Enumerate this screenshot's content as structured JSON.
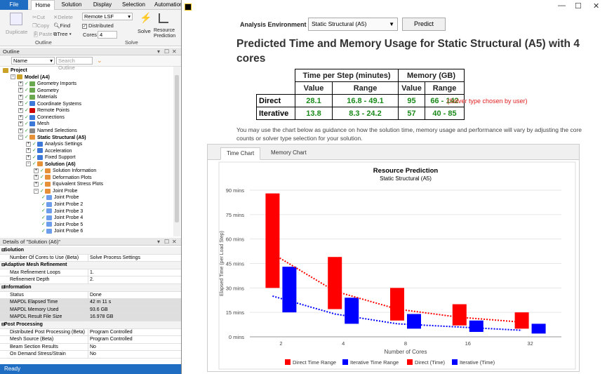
{
  "ribbon": {
    "tabs": [
      "File",
      "Home",
      "Solution",
      "Display",
      "Selection",
      "Automation"
    ],
    "duplicate_label": "Duplicate",
    "cut_label": "Cut",
    "delete_label": "Delete",
    "copy_label": "Copy",
    "find_label": "Find",
    "paste_label": "Paste",
    "tree_label": "Tree",
    "outline_group": "Outline",
    "solve_target": "Remote LSF",
    "distributed_label": "Distributed",
    "cores_label": "Cores",
    "cores_value": "4",
    "solve_label": "Solve",
    "resource_prediction_label": "Resource Prediction",
    "solve_group": "Solve"
  },
  "outline": {
    "title": "Outline",
    "name_label": "Name",
    "search_placeholder": "Search Outline",
    "items": [
      {
        "label": "Project",
        "depth": 0,
        "icon": "project-icon",
        "color": "#c9a227",
        "bold": true
      },
      {
        "label": "Model (A4)",
        "depth": 1,
        "icon": "model-icon",
        "color": "#c9a227",
        "bold": true
      },
      {
        "label": "Geometry Imports",
        "depth": 2,
        "icon": "geometry-imports-icon",
        "color": "#6aa84f"
      },
      {
        "label": "Geometry",
        "depth": 2,
        "icon": "geometry-icon",
        "color": "#6aa84f"
      },
      {
        "label": "Materials",
        "depth": 2,
        "icon": "materials-icon",
        "color": "#6aa84f"
      },
      {
        "label": "Coordinate Systems",
        "depth": 2,
        "icon": "coordinate-systems-icon",
        "color": "#3c78d8"
      },
      {
        "label": "Remote Points",
        "depth": 2,
        "icon": "remote-points-icon",
        "color": "#cc0000"
      },
      {
        "label": "Connections",
        "depth": 2,
        "icon": "connections-icon",
        "color": "#3c78d8"
      },
      {
        "label": "Mesh",
        "depth": 2,
        "icon": "mesh-icon",
        "color": "#3c78d8"
      },
      {
        "label": "Named Selections",
        "depth": 2,
        "icon": "named-selections-icon",
        "color": "#888888"
      },
      {
        "label": "Static Structural (A5)",
        "depth": 2,
        "icon": "static-structural-icon",
        "color": "#e69138",
        "bold": true
      },
      {
        "label": "Analysis Settings",
        "depth": 3,
        "icon": "analysis-settings-icon",
        "color": "#3c78d8"
      },
      {
        "label": "Acceleration",
        "depth": 3,
        "icon": "acceleration-icon",
        "color": "#3c78d8"
      },
      {
        "label": "Fixed Support",
        "depth": 3,
        "icon": "fixed-support-icon",
        "color": "#3c78d8"
      },
      {
        "label": "Solution (A6)",
        "depth": 3,
        "icon": "solution-icon",
        "color": "#e69138",
        "bold": true
      },
      {
        "label": "Solution Information",
        "depth": 4,
        "icon": "solution-information-icon",
        "color": "#e69138"
      },
      {
        "label": "Deformation Plots",
        "depth": 4,
        "icon": "deformation-plots-icon",
        "color": "#e69138"
      },
      {
        "label": "Equivalent Stress Plots",
        "depth": 4,
        "icon": "equivalent-stress-plots-icon",
        "color": "#e69138"
      },
      {
        "label": "Joint Probe",
        "depth": 4,
        "icon": "joint-probe-folder-icon",
        "color": "#e69138"
      },
      {
        "label": "Joint Probe",
        "depth": 5,
        "icon": "joint-probe-icon",
        "color": "#6d9eeb"
      },
      {
        "label": "Joint Probe 2",
        "depth": 5,
        "icon": "joint-probe-icon",
        "color": "#6d9eeb"
      },
      {
        "label": "Joint Probe 3",
        "depth": 5,
        "icon": "joint-probe-icon",
        "color": "#6d9eeb"
      },
      {
        "label": "Joint Probe 4",
        "depth": 5,
        "icon": "joint-probe-icon",
        "color": "#6d9eeb"
      },
      {
        "label": "Joint Probe 5",
        "depth": 5,
        "icon": "joint-probe-icon",
        "color": "#6d9eeb"
      },
      {
        "label": "Joint Probe 6",
        "depth": 5,
        "icon": "joint-probe-icon",
        "color": "#6d9eeb"
      }
    ]
  },
  "details": {
    "title": "Details of \"Solution (A6)\"",
    "rows": [
      {
        "key": "Solution",
        "section": true
      },
      {
        "key": "Number Of Cores to Use (Beta)",
        "value": "Solve Process Settings"
      },
      {
        "key": "Adaptive Mesh Refinement",
        "section": true
      },
      {
        "key": "Max Refinement Loops",
        "value": "1."
      },
      {
        "key": "Refinement Depth",
        "value": "2."
      },
      {
        "key": "Information",
        "section": true
      },
      {
        "key": "Status",
        "value": "Done"
      },
      {
        "key": "MAPDL Elapsed Time",
        "value": "42 m 11 s",
        "shade": true
      },
      {
        "key": "MAPDL Memory Used",
        "value": "93.6 GB",
        "shade": true
      },
      {
        "key": "MAPDL Result File Size",
        "value": "16.978 GB",
        "shade": true
      },
      {
        "key": "Post Processing",
        "section": true
      },
      {
        "key": "Distributed Post Processing (Beta)",
        "value": "Program Controlled"
      },
      {
        "key": "Mesh Source (Beta)",
        "value": "Program Controlled"
      },
      {
        "key": "Beam Section Results",
        "value": "No"
      },
      {
        "key": "On Demand Stress/Strain",
        "value": "No"
      }
    ]
  },
  "status": "Ready",
  "dialog": {
    "env_label": "Analysis Environment",
    "env_value": "Static Structural (A5)",
    "predict_label": "Predict",
    "title": "Predicted Time and Memory Usage for Static Structural (A5) with 4 cores",
    "table": {
      "h_time": "Time per Step (minutes)",
      "h_mem": "Memory (GB)",
      "h_value": "Value",
      "h_range": "Range",
      "rows": [
        {
          "label": "Direct",
          "time_value": "28.1",
          "time_range": "16.8 - 49.1",
          "mem_value": "95",
          "mem_range": "66 - 142"
        },
        {
          "label": "Iterative",
          "time_value": "13.8",
          "time_range": "8.3 - 24.2",
          "mem_value": "57",
          "mem_range": "40 - 85"
        }
      ]
    },
    "note": "(Solver type chosen by user)",
    "guidance": "You may use the chart below as guidance on how the solution time, memory usage and performance will vary by adjusting the core counts or solver type selection for your solution.",
    "chart_tabs": [
      "Time Chart",
      "Memory Chart"
    ]
  },
  "chart_data": {
    "type": "bar",
    "title": "Resource Prediction",
    "subtitle": "Static Structural (A5)",
    "xlabel": "Number of Cores",
    "ylabel": "Elapsed Time (per Load Step)",
    "categories": [
      "2",
      "4",
      "8",
      "16",
      "32"
    ],
    "yticks": [
      "0 mins",
      "15 mins",
      "30 mins",
      "45 mins",
      "60 mins",
      "75 mins",
      "90 mins"
    ],
    "ylim": [
      0,
      90
    ],
    "series": [
      {
        "name": "Direct Time Range",
        "color": "#ff0000",
        "low": [
          30,
          17,
          10,
          7,
          5
        ],
        "high": [
          88,
          49,
          30,
          20,
          15
        ]
      },
      {
        "name": "Iterative Time Range",
        "color": "#0000ff",
        "low": [
          15,
          8,
          5,
          3,
          2
        ],
        "high": [
          43,
          24,
          14,
          10,
          8
        ]
      },
      {
        "name": "Direct (Time)",
        "color": "#ff0000",
        "values": [
          51,
          28,
          17,
          12,
          9
        ]
      },
      {
        "name": "Iterative (Time)",
        "color": "#0000ff",
        "values": [
          25,
          14,
          8,
          6,
          4
        ]
      }
    ],
    "legend_position": "bottom"
  }
}
